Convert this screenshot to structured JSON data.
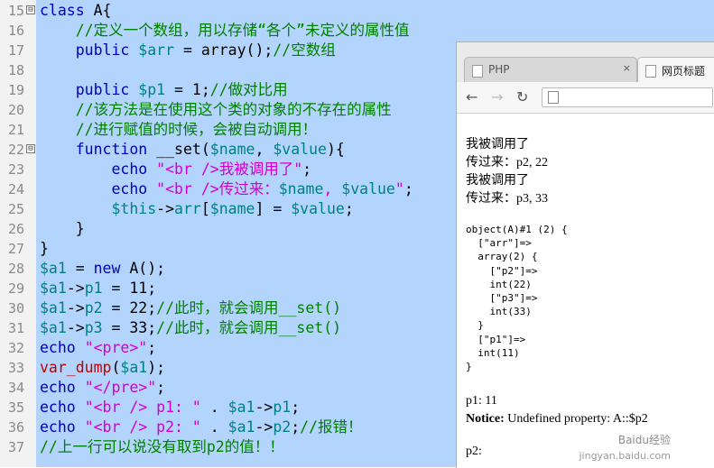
{
  "code_lines": [
    {
      "n": "15",
      "fold": "⊟",
      "parts": [
        [
          "k",
          "class"
        ],
        [
          "t",
          " A{"
        ]
      ]
    },
    {
      "n": "16",
      "parts": [
        [
          "t",
          "    "
        ],
        [
          "c",
          "//定义一个数组，用以存储“各个”未定义的属性值"
        ]
      ]
    },
    {
      "n": "17",
      "parts": [
        [
          "t",
          "    "
        ],
        [
          "k",
          "public"
        ],
        [
          "t",
          " "
        ],
        [
          "v",
          "$arr"
        ],
        [
          "t",
          " = array();"
        ],
        [
          "c",
          "//空数组"
        ]
      ]
    },
    {
      "n": "18",
      "parts": []
    },
    {
      "n": "19",
      "parts": [
        [
          "t",
          "    "
        ],
        [
          "k",
          "public"
        ],
        [
          "t",
          " "
        ],
        [
          "v",
          "$p1"
        ],
        [
          "t",
          " = 1;"
        ],
        [
          "c",
          "//做对比用"
        ]
      ]
    },
    {
      "n": "20",
      "parts": [
        [
          "t",
          "    "
        ],
        [
          "c",
          "//该方法是在使用这个类的对象的不存在的属性"
        ]
      ]
    },
    {
      "n": "21",
      "parts": [
        [
          "t",
          "    "
        ],
        [
          "c",
          "//进行赋值的时候，会被自动调用！"
        ]
      ]
    },
    {
      "n": "22",
      "fold": "⊟",
      "parts": [
        [
          "t",
          "    "
        ],
        [
          "k",
          "function"
        ],
        [
          "t",
          " __set("
        ],
        [
          "v",
          "$name"
        ],
        [
          "t",
          ", "
        ],
        [
          "v",
          "$value"
        ],
        [
          "t",
          "){"
        ]
      ]
    },
    {
      "n": "23",
      "parts": [
        [
          "t",
          "        "
        ],
        [
          "k",
          "echo"
        ],
        [
          "t",
          " "
        ],
        [
          "s",
          "\"<br />我被调用了\""
        ],
        [
          "t",
          ";"
        ]
      ]
    },
    {
      "n": "24",
      "parts": [
        [
          "t",
          "        "
        ],
        [
          "k",
          "echo"
        ],
        [
          "t",
          " "
        ],
        [
          "s",
          "\"<br />传过来："
        ],
        [
          "v",
          "$name"
        ],
        [
          "s",
          ", "
        ],
        [
          "v",
          "$value"
        ],
        [
          "s",
          "\""
        ],
        [
          "t",
          ";"
        ]
      ]
    },
    {
      "n": "25",
      "parts": [
        [
          "t",
          "        "
        ],
        [
          "v",
          "$this"
        ],
        [
          "t",
          "->"
        ],
        [
          "v",
          "arr"
        ],
        [
          "t",
          "["
        ],
        [
          "v",
          "$name"
        ],
        [
          "t",
          "] = "
        ],
        [
          "v",
          "$value"
        ],
        [
          "t",
          ";"
        ]
      ]
    },
    {
      "n": "26",
      "parts": [
        [
          "t",
          "    }"
        ]
      ]
    },
    {
      "n": "27",
      "parts": [
        [
          "t",
          "}"
        ]
      ]
    },
    {
      "n": "28",
      "parts": [
        [
          "v",
          "$a1"
        ],
        [
          "t",
          " = "
        ],
        [
          "k",
          "new"
        ],
        [
          "t",
          " A();"
        ]
      ]
    },
    {
      "n": "29",
      "parts": [
        [
          "v",
          "$a1"
        ],
        [
          "t",
          "->"
        ],
        [
          "v",
          "p1"
        ],
        [
          "t",
          " = 11;"
        ]
      ]
    },
    {
      "n": "30",
      "parts": [
        [
          "v",
          "$a1"
        ],
        [
          "t",
          "->"
        ],
        [
          "v",
          "p2"
        ],
        [
          "t",
          " = 22;"
        ],
        [
          "c",
          "//此时，就会调用__set()"
        ]
      ]
    },
    {
      "n": "31",
      "parts": [
        [
          "v",
          "$a1"
        ],
        [
          "t",
          "->"
        ],
        [
          "v",
          "p3"
        ],
        [
          "t",
          " = 33;"
        ],
        [
          "c",
          "//此时，就会调用__set()"
        ]
      ]
    },
    {
      "n": "32",
      "parts": [
        [
          "k",
          "echo"
        ],
        [
          "t",
          " "
        ],
        [
          "s",
          "\"<pre>\""
        ],
        [
          "t",
          ";"
        ]
      ]
    },
    {
      "n": "33",
      "parts": [
        [
          "f",
          "var_dump"
        ],
        [
          "t",
          "("
        ],
        [
          "v",
          "$a1"
        ],
        [
          "t",
          ");"
        ]
      ]
    },
    {
      "n": "34",
      "parts": [
        [
          "k",
          "echo"
        ],
        [
          "t",
          " "
        ],
        [
          "s",
          "\"</pre>\""
        ],
        [
          "t",
          ";"
        ]
      ]
    },
    {
      "n": "35",
      "parts": [
        [
          "k",
          "echo"
        ],
        [
          "t",
          " "
        ],
        [
          "s",
          "\"<br /> p1: \""
        ],
        [
          "t",
          " . "
        ],
        [
          "v",
          "$a1"
        ],
        [
          "t",
          "->"
        ],
        [
          "v",
          "p1"
        ],
        [
          "t",
          ";"
        ]
      ]
    },
    {
      "n": "36",
      "parts": [
        [
          "k",
          "echo"
        ],
        [
          "t",
          " "
        ],
        [
          "s",
          "\"<br /> p2: \""
        ],
        [
          "t",
          " . "
        ],
        [
          "v",
          "$a1"
        ],
        [
          "t",
          "->"
        ],
        [
          "v",
          "p2"
        ],
        [
          "t",
          ";"
        ],
        [
          "c",
          "//报错！"
        ]
      ]
    },
    {
      "n": "37",
      "parts": [
        [
          "c",
          "//上一行可以说没有取到p2的值！！"
        ]
      ]
    }
  ],
  "browser": {
    "tabs": [
      {
        "label": "PHP",
        "close": "×"
      },
      {
        "label": "网页标题",
        "close": ""
      }
    ],
    "nav": {
      "back": "←",
      "forward": "→",
      "reload": "↻"
    },
    "output_lines": [
      "我被调用了",
      "传过来：p2, 22",
      "我被调用了",
      "传过来：p3, 33"
    ],
    "pre_lines": [
      "object(A)#1 (2) {",
      "  [\"arr\"]=>",
      "  array(2) {",
      "    [\"p2\"]=>",
      "    int(22)",
      "    [\"p3\"]=>",
      "    int(33)",
      "  }",
      "  [\"p1\"]=>",
      "  int(11)",
      "}"
    ],
    "p1_line": "p1: 11",
    "notice_label": "Notice:",
    "notice_text": " Undefined property: A::$p2",
    "p2_line": "p2:"
  },
  "watermark": {
    "line1": "Baidu经验",
    "line2": "jingyan.baidu.com"
  }
}
